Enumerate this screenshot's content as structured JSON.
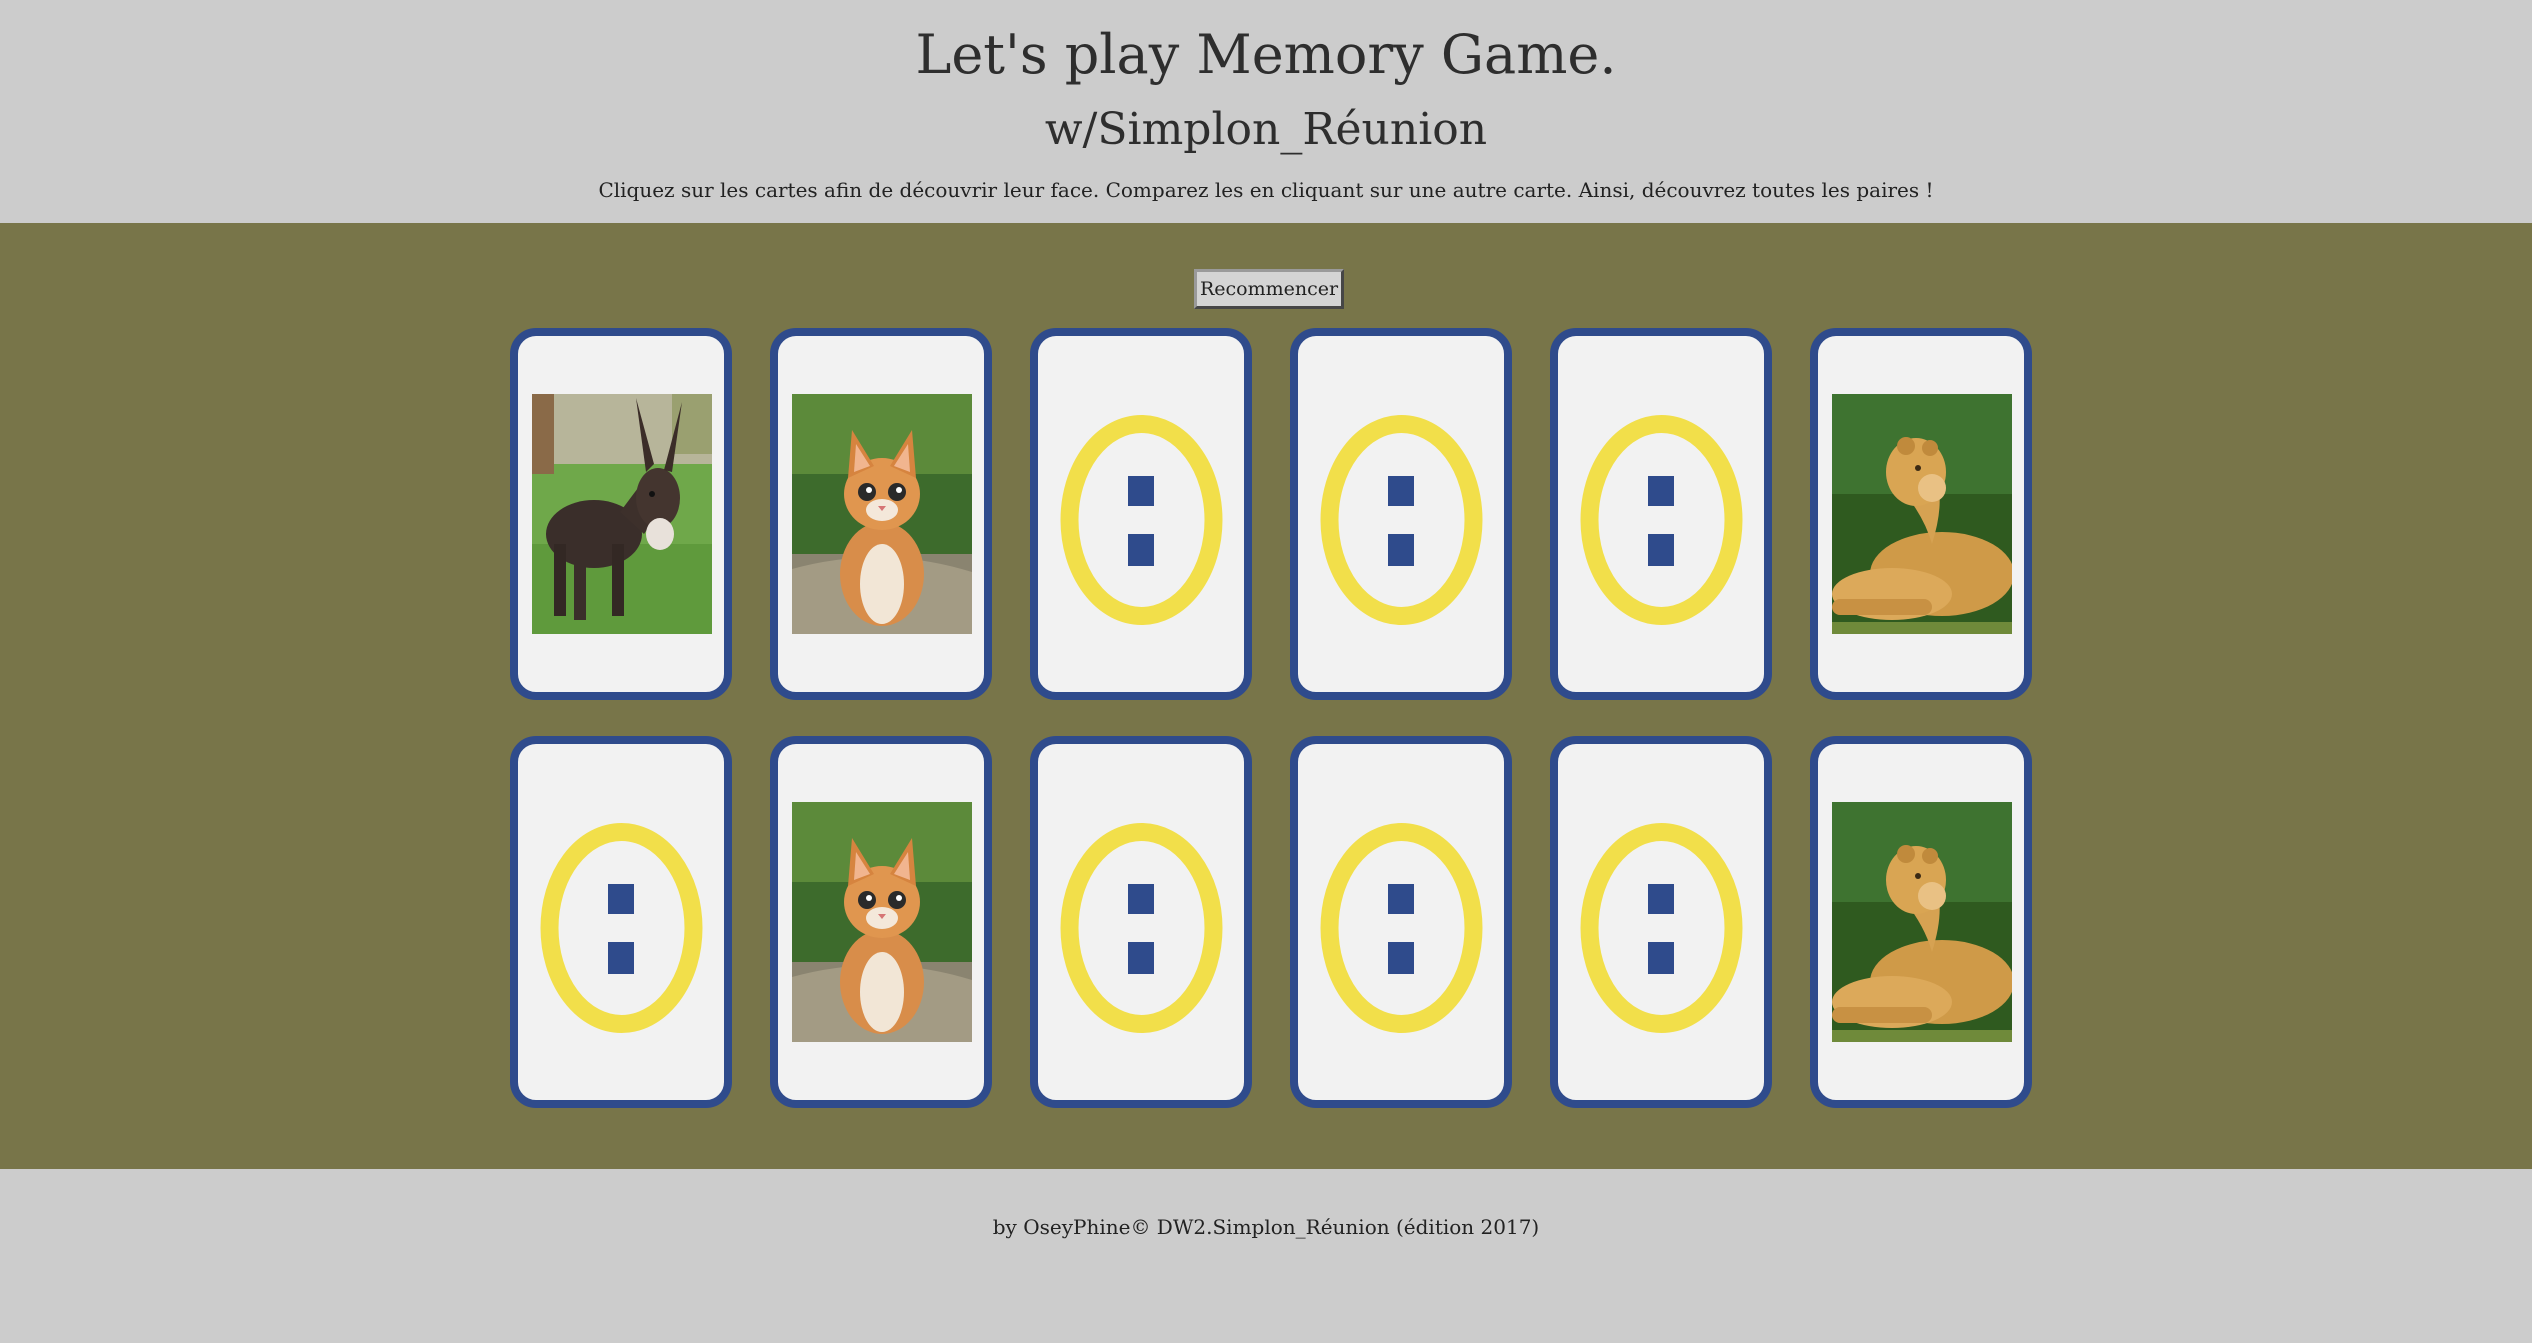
{
  "header": {
    "title": "Let's play Memory Game.",
    "subtitle": "w/Simplon_Réunion",
    "instructions": "Cliquez sur les cartes afin de découvrir leur face. Comparez les en cliquant sur une autre carte. Ainsi, découvrez toutes les paires !"
  },
  "game": {
    "restart_label": "Recommencer",
    "colors": {
      "board": "#787549",
      "card_border": "#2f4b8c",
      "card_face": "#f2f2f2",
      "emblem_ring": "#f2df4a",
      "emblem_marks": "#2f4b8c"
    },
    "cards": [
      {
        "state": "revealed",
        "image": "donkey"
      },
      {
        "state": "revealed",
        "image": "kitten"
      },
      {
        "state": "hidden",
        "image": "card-back-emblem"
      },
      {
        "state": "hidden",
        "image": "card-back-emblem"
      },
      {
        "state": "hidden",
        "image": "card-back-emblem"
      },
      {
        "state": "revealed",
        "image": "lioness"
      },
      {
        "state": "hidden",
        "image": "card-back-emblem"
      },
      {
        "state": "revealed",
        "image": "kitten"
      },
      {
        "state": "hidden",
        "image": "card-back-emblem"
      },
      {
        "state": "hidden",
        "image": "card-back-emblem"
      },
      {
        "state": "hidden",
        "image": "card-back-emblem"
      },
      {
        "state": "revealed",
        "image": "lioness"
      }
    ]
  },
  "footer": {
    "credit": "by OseyPhine© DW2.Simplon_Réunion (édition 2017)"
  }
}
